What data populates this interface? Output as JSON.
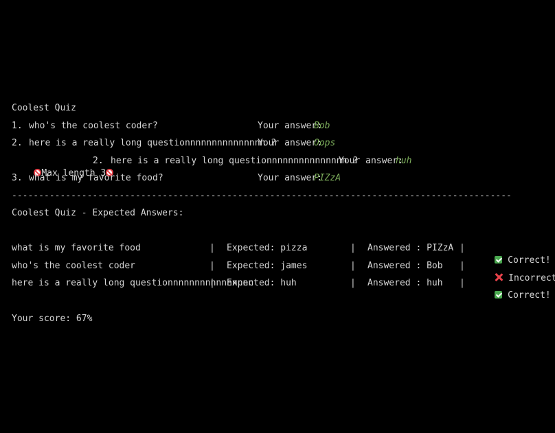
{
  "quiz": {
    "title": "Coolest Quiz",
    "answer_label": "Your answer:",
    "questions": [
      {
        "number": "1.",
        "text": "who's the coolest coder?",
        "answer": "Bob"
      },
      {
        "number": "2.",
        "text": "here is a really long questionnnnnnnnnnnnnnn ?",
        "answer": "Oops"
      },
      {
        "number": "2.",
        "text": "here is a really long questionnnnnnnnnnnnnnn ?",
        "answer": "huh",
        "warning": "Max length 3"
      },
      {
        "number": "3.",
        "text": "what is my favorite food?",
        "answer": "PIZzA"
      }
    ],
    "separator": "-----------------------------------------------------------------------------------------------------------"
  },
  "results": {
    "title": "Coolest Quiz - Expected Answers:",
    "pipe": "|",
    "rows": [
      {
        "question": "what is my favorite food",
        "expected": "Expected: pizza",
        "answered": "Answered : PIZzA",
        "status": "Correct!",
        "status_icon": "check-icon"
      },
      {
        "question": "who's the coolest coder",
        "expected": "Expected: james",
        "answered": "Answered : Bob",
        "status": "Incorrect",
        "status_icon": "cross-icon"
      },
      {
        "question": "here is a really long questionnnnnnnnnnnnnnnn",
        "expected": "Expected: huh",
        "answered": "Answered : huh",
        "status": "Correct!",
        "status_icon": "check-icon"
      }
    ],
    "score": "Your score: 67%"
  },
  "colors": {
    "background": "#000000",
    "text": "#d6d6d6",
    "answer": "#7dae5c",
    "warning_red": "#e8424a",
    "check_green": "#4aa84f"
  }
}
